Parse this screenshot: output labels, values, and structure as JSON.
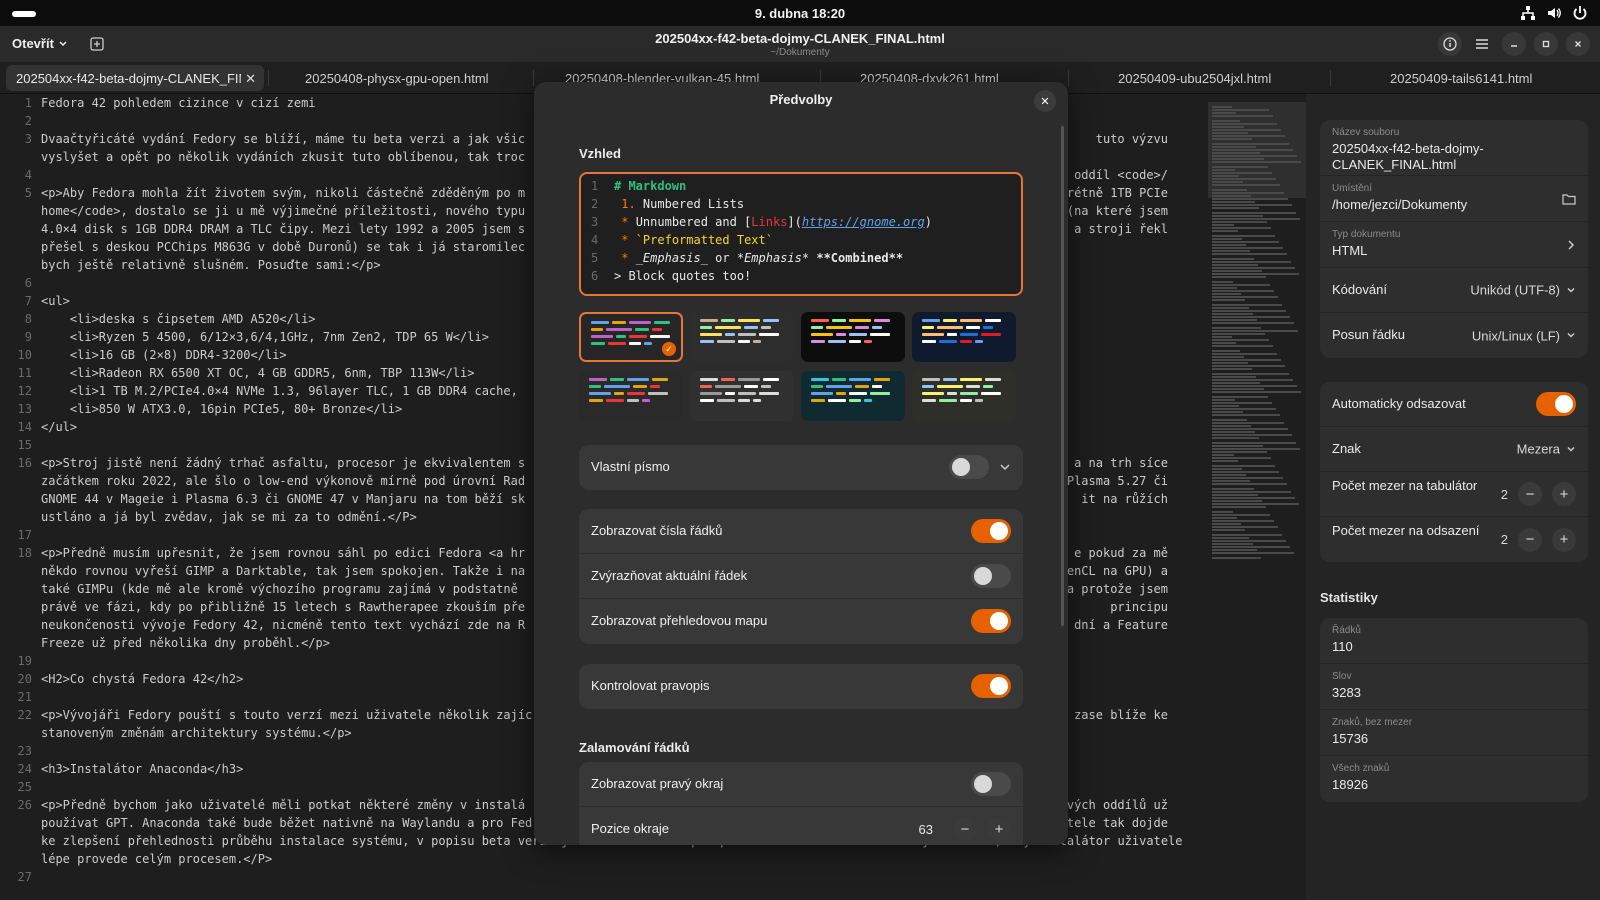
{
  "topbar": {
    "clock": "9. dubna  18:20"
  },
  "header": {
    "open_label": "Otevřít",
    "title": "202504xx-f42-beta-dojmy-CLANEK_FINAL.html",
    "subtitle": "~/Dokumenty"
  },
  "tabs": [
    "202504xx-f42-beta-dojmy-CLANEK_FINAL.html",
    "20250408-physx-gpu-open.html",
    "20250408-blender-vulkan-45.html",
    "20250408-dxvk261.html",
    "20250409-ubu2504jxl.html",
    "20250409-tails6141.html"
  ],
  "editor_lines": [
    {
      "n": "1",
      "t": "Fedora 42 pohledem cizince v cizí zemi"
    },
    {
      "n": "2",
      "t": ""
    },
    {
      "n": "3",
      "t": "Dvaačtyřicáté vydání Fedory se blíží, máme tu beta verzi a jak všic"
    },
    {
      "n": "",
      "t": "vyslyšet a opět po několik vydáních zkusit tuto oblíbenou, tak troc"
    },
    {
      "n": "4",
      "t": ""
    },
    {
      "n": "5",
      "t": "<p>Aby Fedora mohla žít životem svým, nikoli částečně zděděným po m"
    },
    {
      "n": "",
      "t": "home</code>, dostalo se ji u mě výjimečné příležitosti, nového typu"
    },
    {
      "n": "",
      "t": "4.0×4 disk s 1GB DDR4 DRAM a TLC čipy. Mezi lety 1992 a 2005 jsem s"
    },
    {
      "n": "",
      "t": "přešel s deskou PCChips M863G v době Duronů) se tak i já staromilec"
    },
    {
      "n": "",
      "t": "bych ještě relativně slušném. Posuďte sami:</p>"
    },
    {
      "n": "6",
      "t": ""
    },
    {
      "n": "7",
      "t": "<ul>"
    },
    {
      "n": "8",
      "t": "    <li>deska s čipsetem AMD A520</li>"
    },
    {
      "n": "9",
      "t": "    <li>Ryzen 5 4500, 6/12×3,6/4,1GHz, 7nm Zen2, TDP 65 W</li>"
    },
    {
      "n": "10",
      "t": "    <li>16 GB (2×8) DDR4-3200</li>"
    },
    {
      "n": "11",
      "t": "    <li>Radeon RX 6500 XT OC, 4 GB GDDR5, 6nm, TBP 113W</li>"
    },
    {
      "n": "12",
      "t": "    <li>1 TB M.2/PCIe4.0×4 NVMe 1.3, 96layer TLC, 1 GB DDR4 cache,"
    },
    {
      "n": "13",
      "t": "    <li>850 W ATX3.0, 16pin PCIe5, 80+ Bronze</li>"
    },
    {
      "n": "14",
      "t": "</ul>"
    },
    {
      "n": "15",
      "t": ""
    },
    {
      "n": "16",
      "t": "<p>Stroj jistě není žádný trhač asfaltu, procesor je ekvivalentem s"
    },
    {
      "n": "",
      "t": "začátkem roku 2022, ale šlo o low-end výkonově mírně pod úrovní Rad"
    },
    {
      "n": "",
      "t": "GNOME 44 v Mageie i Plasma 6.3 či GNOME 47 v Manjaru na tom běží sk"
    },
    {
      "n": "",
      "t": "ustláno a já byl zvědav, jak se mi za to odmění.</P>"
    },
    {
      "n": "17",
      "t": ""
    },
    {
      "n": "18",
      "t": "<p>Předně musím upřesnit, že jsem rovnou sáhl po edici Fedora <a hr"
    },
    {
      "n": "",
      "t": "někdo rovnou vyřeší GIMP a Darktable, tak jsem spokojen. Takže i na"
    },
    {
      "n": "",
      "t": "také GIMPu (kde mě ale kromě výchozího programu zajímá v podstatně"
    },
    {
      "n": "",
      "t": "právě ve fázi, kdy po přibližně 15 letech s Rawtherapee zkouším pře"
    },
    {
      "n": "",
      "t": "neukončenosti vývoje Fedory 42, nicméně tento text vychází zde na R"
    },
    {
      "n": "",
      "t": "Freeze už před několika dny proběhl.</p>"
    },
    {
      "n": "19",
      "t": ""
    },
    {
      "n": "20",
      "t": "<H2>Co chystá Fedora 42</h2>"
    },
    {
      "n": "21",
      "t": ""
    },
    {
      "n": "22",
      "t": "<p>Vývojáři Fedory pouští s touto verzí mezi uživatele několik zajíc"
    },
    {
      "n": "",
      "t": "stanoveným změnám architektury systému.</p>"
    },
    {
      "n": "23",
      "t": ""
    },
    {
      "n": "24",
      "t": "<h3>Instalátor Anaconda</h3>"
    },
    {
      "n": "25",
      "t": ""
    },
    {
      "n": "26",
      "t": "<p>Předně bychom jako uživatelé měli potkat některé změny v instalá"
    },
    {
      "n": "",
      "t": "používat GPT. Anaconda také bude běžet nativně na Waylandu a pro Fed"
    },
    {
      "n": "",
      "t": "ke zlepšení přehlednosti průběhu instalace systému, v popisu beta verze je zmíněna také lepší přehlednost nastavení diskových oddílů, kdy instalátor uživatele"
    },
    {
      "n": "",
      "t": "lépe provede celým procesem.</P>"
    },
    {
      "n": "27",
      "t": ""
    }
  ],
  "editor_right_fragments": [
    {
      "line": 3,
      "t": "tuto výzvu"
    },
    {
      "line": 5,
      "t": "ý oddíl <code>/"
    },
    {
      "line": 6,
      "t": "nkrétně 1TB PCIe"
    },
    {
      "line": 7,
      "t": "(na které jsem"
    },
    {
      "line": 8,
      "t": "a stroji řekl"
    },
    {
      "line": 21,
      "t": "a na trh síce"
    },
    {
      "line": 22,
      "t": "Plasma 5.27 či"
    },
    {
      "line": 23,
      "t": "it na růžích"
    },
    {
      "line": 26,
      "t": "e pokud za mě"
    },
    {
      "line": 27,
      "t": "OpenCL na GPU) a"
    },
    {
      "line": 28,
      "t": "a protože jsem"
    },
    {
      "line": 29,
      "t": "principu"
    },
    {
      "line": 30,
      "t": "dní a Feature"
    },
    {
      "line": 35,
      "t": "zase blíže ke"
    },
    {
      "line": 40,
      "t": "kových oddílů už"
    },
    {
      "line": 41,
      "t": "ivatele tak dojde"
    }
  ],
  "dialog": {
    "title": "Předvolby",
    "section_appearance": "Vzhled",
    "preview_lines": [
      "1",
      "2",
      "3",
      "4",
      "5",
      "6"
    ],
    "custom_font": "Vlastní písmo",
    "show_line_numbers": "Zobrazovat čísla řádků",
    "highlight_line": "Zvýrazňovat aktuální řádek",
    "show_map": "Zobrazovat přehledovou mapu",
    "spellcheck": "Kontrolovat pravopis",
    "section_wrap": "Zalamování řádků",
    "show_margin": "Zobrazovat pravý okraj",
    "margin_position": "Pozice okraje",
    "margin_value": "63"
  },
  "sidebar": {
    "filename_cap": "Název souboru",
    "filename": "202504xx-f42-beta-dojmy-CLANEK_FINAL.html",
    "location_cap": "Umístění",
    "location": "/home/jezci/Dokumenty",
    "doctype_cap": "Typ dokumentu",
    "doctype": "HTML",
    "encoding_label": "Kódování",
    "encoding_value": "Unikód (UTF-8)",
    "lineend_label": "Posun řádku",
    "lineend_value": "Unix/Linux (LF)",
    "autoindent_label": "Automaticky odsazovat",
    "char_label": "Znak",
    "char_value": "Mezera",
    "tabwidth_label": "Počet mezer na tabulátor",
    "tabwidth_value": "2",
    "indentwidth_label": "Počet mezer na odsazení",
    "indentwidth_value": "2",
    "stats_heading": "Statistiky",
    "lines_cap": "Řádků",
    "lines": "110",
    "words_cap": "Slov",
    "words": "3283",
    "chars_nospace_cap": "Znaků, bez mezer",
    "chars_nospace": "15736",
    "chars_all_cap": "Všech znaků",
    "chars_all": "18926"
  },
  "colors": {
    "accent": "#e66100",
    "accent_border": "#e5753a"
  }
}
